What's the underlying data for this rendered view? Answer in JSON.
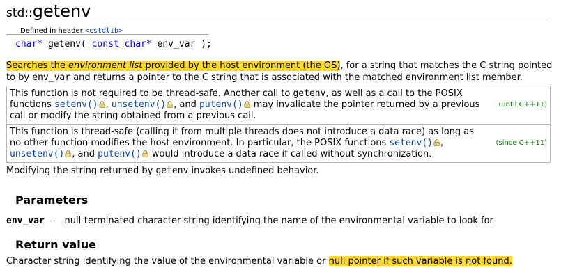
{
  "title": {
    "namespace": "std::",
    "name": "getenv"
  },
  "declaration": {
    "defined_in_label": "Defined in header",
    "header_link": "<cstdlib>",
    "ret_type": "char*",
    "func": "getenv(",
    "kw_const": "const",
    "param_type": "char*",
    "param_end": "env_var );"
  },
  "description": {
    "hl_part1": "Searches the ",
    "hl_em": "environment list",
    "hl_part2": " provided by the host environment (the OS)",
    "rest1": ", for a string that matches the C string pointed to by ",
    "code_env_var": "env_var",
    "rest2": " and returns a pointer to the C string that is associated with the matched environment list member."
  },
  "thread_box": {
    "row1": {
      "t1": "This function is not required to be thread-safe. Another call to ",
      "c_getenv": "getenv",
      "t2": ", as well as a call to the POSIX functions ",
      "link_setenv": "setenv()",
      "link_unsetenv": "unsetenv()",
      "t_and": ", and ",
      "link_putenv": "putenv()",
      "t3": " may invalidate the pointer returned by a previous call or modify the string obtained from a previous call.",
      "version": "(until C++11)"
    },
    "row2": {
      "t1": "This function is thread-safe (calling it from multiple threads does not introduce a data race) as long as no other function modifies the host environment. In particular, the POSIX functions ",
      "link_setenv": "setenv()",
      "link_unsetenv": "unsetenv()",
      "t_and": ", and ",
      "link_putenv": "putenv()",
      "t3": " would introduce a data race if called without synchronization.",
      "version": "(since C++11)"
    }
  },
  "modify_note": {
    "t1": "Modifying the string returned by ",
    "code": "getenv",
    "t2": " invokes undefined behavior."
  },
  "parameters": {
    "heading": "Parameters",
    "name": "env_var",
    "dash": "-",
    "desc": "null-terminated character string identifying the name of the environmental variable to look for"
  },
  "return_value": {
    "heading": "Return value",
    "text": "Character string identifying the value of the environmental variable or ",
    "highlight": "null pointer if such variable is not found."
  },
  "colors": {
    "link": "#0645ad",
    "highlight": "#fdd835",
    "version": "#008000",
    "keyword": "#0000ff"
  },
  "icons": {
    "lock": "lock-icon"
  }
}
